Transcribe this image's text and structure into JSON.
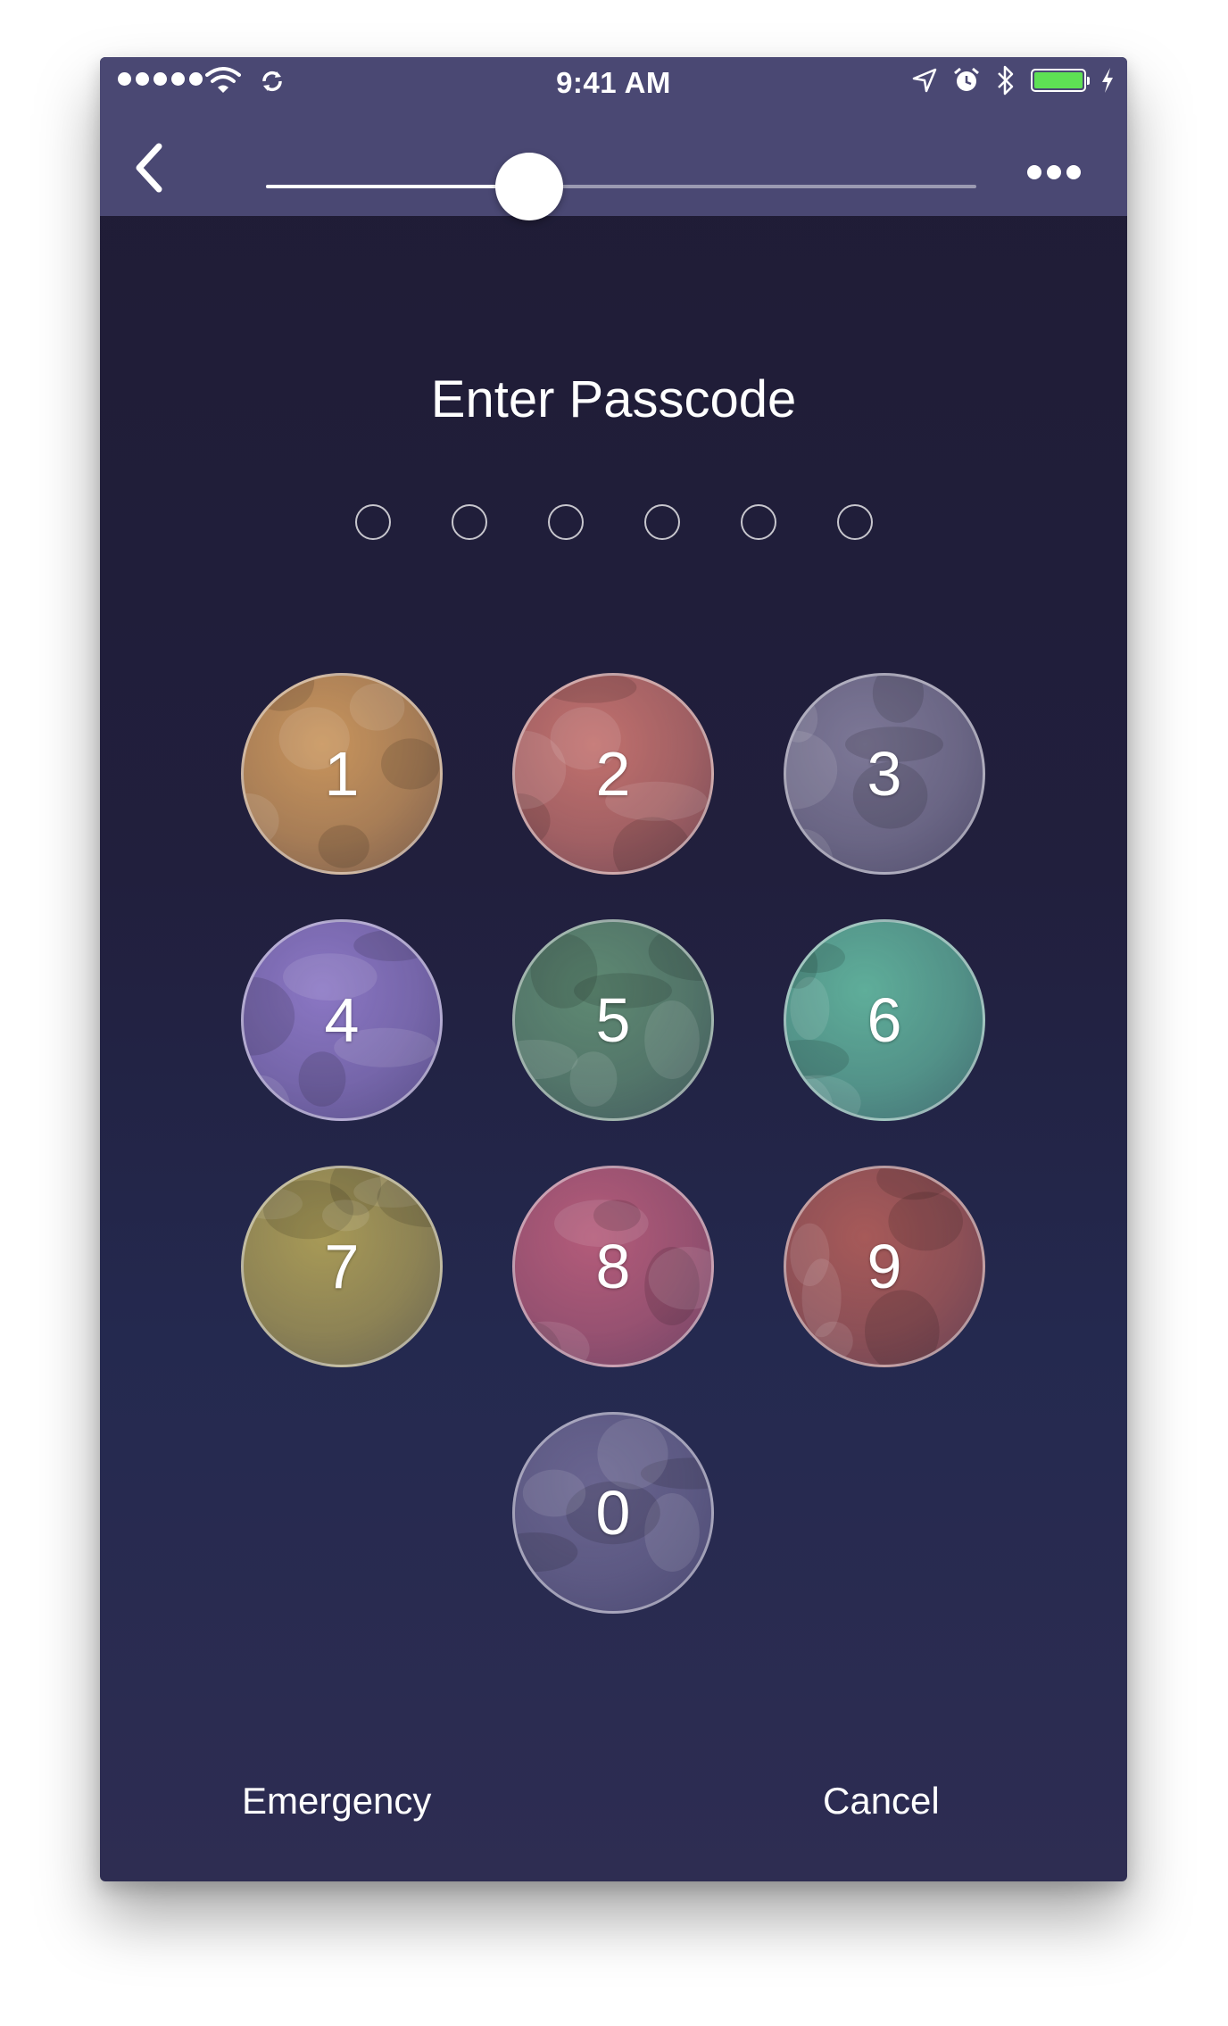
{
  "status_bar": {
    "time": "9:41 AM",
    "signal_icon": "signal-dots-icon",
    "wifi_icon": "wifi-icon",
    "sync_icon": "sync-icon",
    "location_icon": "location-arrow-icon",
    "alarm_icon": "alarm-icon",
    "bluetooth_icon": "bluetooth-icon",
    "battery_icon": "battery-icon",
    "battery_color": "#5ee054",
    "charging_icon": "bolt-icon"
  },
  "toolbar": {
    "back_icon": "chevron-left-icon",
    "slider_value": 0.37,
    "more_icon": "ellipsis-icon",
    "background": "#4a4873"
  },
  "passcode": {
    "title": "Enter Passcode",
    "dot_count": 6,
    "filled": 0
  },
  "keypad": {
    "keys": [
      {
        "digit": "1",
        "tint": "#c9955d"
      },
      {
        "digit": "2",
        "tint": "#c2716e"
      },
      {
        "digit": "3",
        "tint": "#7d7897"
      },
      {
        "digit": "4",
        "tint": "#8b77c4"
      },
      {
        "digit": "5",
        "tint": "#5f8a73"
      },
      {
        "digit": "6",
        "tint": "#5fae9a"
      },
      {
        "digit": "7",
        "tint": "#a89a57"
      },
      {
        "digit": "8",
        "tint": "#b45c7a"
      },
      {
        "digit": "9",
        "tint": "#a75a59"
      },
      {
        "digit": "0",
        "tint": "#6a6590"
      }
    ]
  },
  "footer": {
    "emergency_label": "Emergency",
    "cancel_label": "Cancel"
  }
}
